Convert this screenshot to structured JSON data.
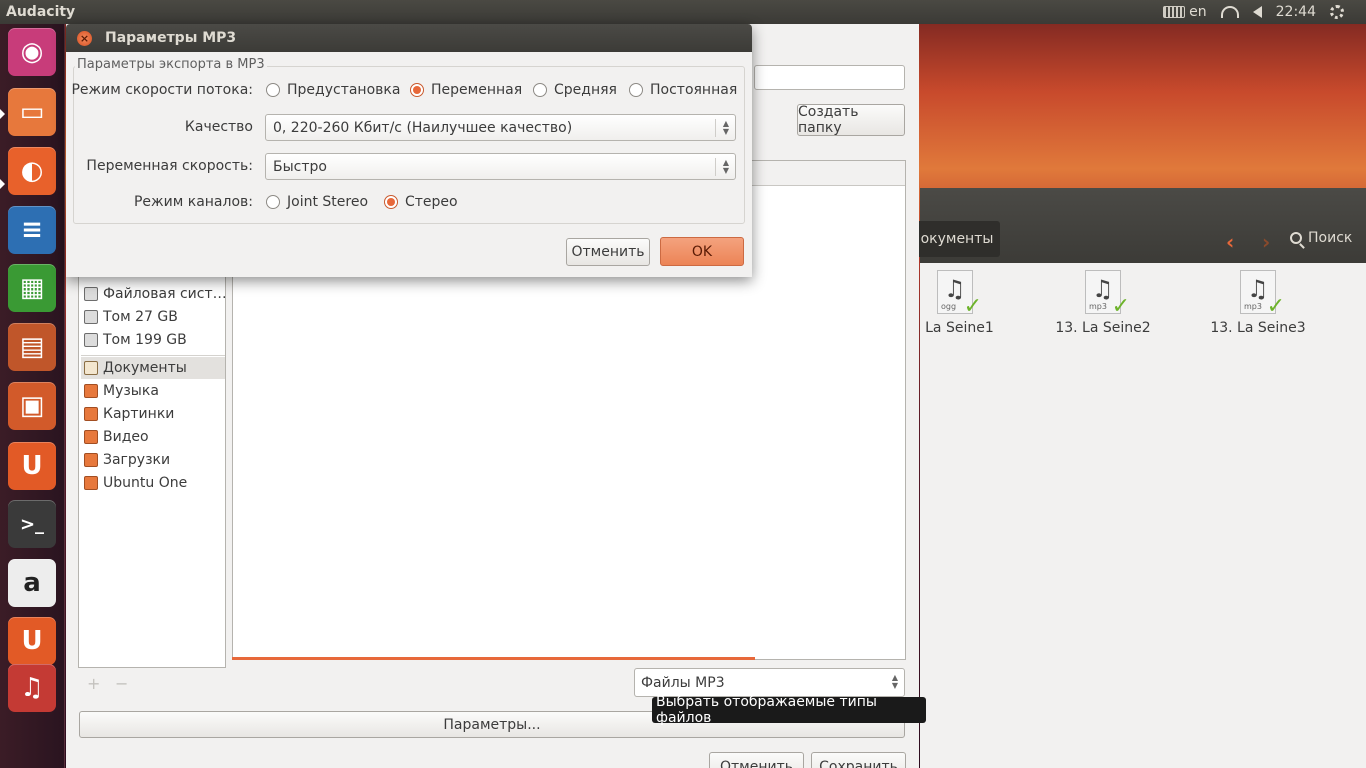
{
  "top_panel": {
    "app_name": "Audacity",
    "keyboard_layout": "en",
    "clock": "22:44"
  },
  "launcher": {
    "items": [
      {
        "name": "ubuntu-dash",
        "glyph": "◉",
        "color": "#c83c7a"
      },
      {
        "name": "files",
        "glyph": "▭",
        "color": "#e7783c"
      },
      {
        "name": "firefox",
        "glyph": "◐",
        "color": "#e8612b"
      },
      {
        "name": "libreoffice-writer",
        "glyph": "≡",
        "color": "#2d6fb3"
      },
      {
        "name": "libreoffice-calc",
        "glyph": "▦",
        "color": "#3a9a34"
      },
      {
        "name": "libreoffice-impress",
        "glyph": "▤",
        "color": "#c0562a"
      },
      {
        "name": "software-center",
        "glyph": "▣",
        "color": "#d25a2a"
      },
      {
        "name": "ubuntu-one",
        "glyph": "U",
        "color": "#e25a26"
      },
      {
        "name": "terminal",
        "glyph": ">_",
        "color": "#3a3a3a"
      },
      {
        "name": "amazon",
        "glyph": "a",
        "color": "#ededed"
      },
      {
        "name": "ubuntu-one-music",
        "glyph": "U",
        "color": "#e25a26"
      },
      {
        "name": "audacity",
        "glyph": "♫",
        "color": "#c43a34"
      }
    ]
  },
  "file_manager": {
    "tab_label": "окументы",
    "search_label": "Поиск",
    "files": [
      {
        "name": ". La Seine1",
        "ext": "ogg"
      },
      {
        "name": "13. La Seine2",
        "ext": "mp3"
      },
      {
        "name": "13. La Seine3",
        "ext": "mp3"
      }
    ]
  },
  "export_dialog": {
    "create_folder_label": "Создать папку",
    "places": [
      {
        "label": "Файловая сист…",
        "icon": "drive-icon"
      },
      {
        "label": "Том 27 GB",
        "icon": "drive-icon"
      },
      {
        "label": "Том 199 GB",
        "icon": "drive-icon"
      },
      {
        "label": "Документы",
        "icon": "folder-documents-icon"
      },
      {
        "label": "Музыка",
        "icon": "folder-music-icon"
      },
      {
        "label": "Картинки",
        "icon": "folder-pictures-icon"
      },
      {
        "label": "Видео",
        "icon": "folder-video-icon"
      },
      {
        "label": "Загрузки",
        "icon": "folder-downloads-icon"
      },
      {
        "label": "Ubuntu One",
        "icon": "folder-ubuntuone-icon"
      }
    ],
    "add_label": "+",
    "remove_label": "−",
    "file_type": "Файлы MP3",
    "file_type_tooltip": "Выбрать отображаемые типы файлов",
    "options_label": "Параметры...",
    "cancel_label": "Отменить",
    "save_label": "Сохранить"
  },
  "mp3_dialog": {
    "title": "Параметры MP3",
    "group_label": "Параметры экспорта в MP3",
    "bitrate_mode_label": "Режим скорости потока:",
    "bitrate_modes": [
      {
        "label": "Предустановка",
        "selected": false
      },
      {
        "label": "Переменная",
        "selected": true
      },
      {
        "label": "Средняя",
        "selected": false
      },
      {
        "label": "Постоянная",
        "selected": false
      }
    ],
    "quality_label": "Качество",
    "quality_value": "0, 220-260 Кбит/с (Наилучшее качество)",
    "variable_speed_label": "Переменная скорость:",
    "variable_speed_value": "Быстро",
    "channel_mode_label": "Режим каналов:",
    "channel_modes": [
      {
        "label": "Joint Stereo",
        "selected": false
      },
      {
        "label": "Стерео",
        "selected": true
      }
    ],
    "cancel_label": "Отменить",
    "ok_label": "OK"
  }
}
